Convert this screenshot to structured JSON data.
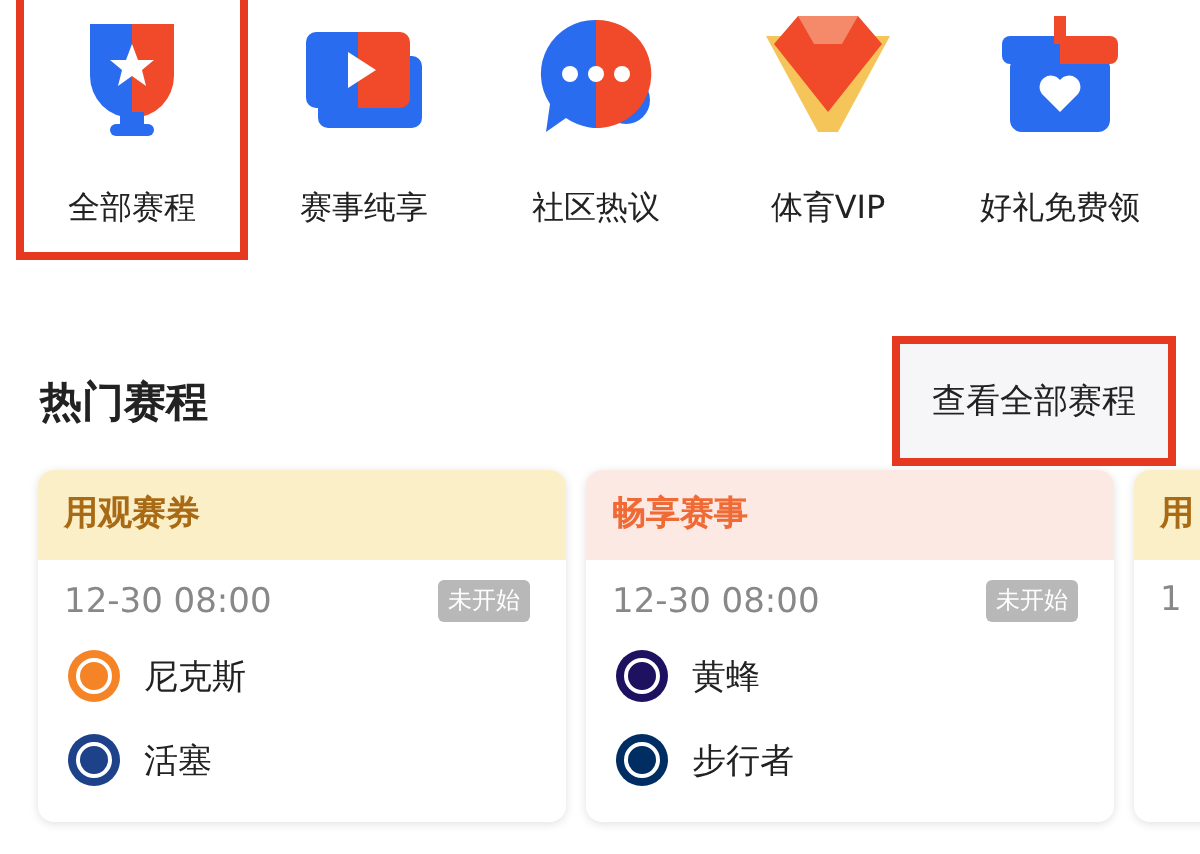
{
  "nav": [
    {
      "label": "全部赛程",
      "highlighted": true
    },
    {
      "label": "赛事纯享",
      "highlighted": false
    },
    {
      "label": "社区热议",
      "highlighted": false
    },
    {
      "label": "体育VIP",
      "highlighted": false
    },
    {
      "label": "好礼免费领",
      "highlighted": false
    }
  ],
  "section": {
    "title": "热门赛程",
    "link": "查看全部赛程",
    "link_highlighted": true
  },
  "cards": [
    {
      "kind": "gold",
      "header": "用观赛券",
      "time": "12-30 08:00",
      "status": "未开始",
      "teams": [
        {
          "name": "尼克斯"
        },
        {
          "name": "活塞"
        }
      ]
    },
    {
      "kind": "peach",
      "header": "畅享赛事",
      "time": "12-30 08:00",
      "status": "未开始",
      "teams": [
        {
          "name": "黄蜂"
        },
        {
          "name": "步行者"
        }
      ]
    },
    {
      "kind": "gold",
      "header": "用",
      "time": "1"
    }
  ]
}
